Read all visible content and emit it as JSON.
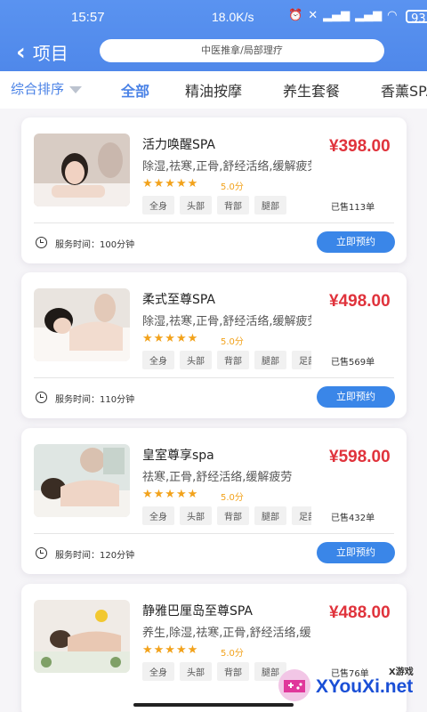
{
  "status_bar": {
    "time": "15:57",
    "speed": "18.0K/s",
    "battery": "93"
  },
  "header": {
    "back_label": "项目",
    "search_text": "中医推拿/局部理疗"
  },
  "tabs": {
    "sort_label": "综合排序",
    "items": [
      "全部",
      "精油按摩",
      "养生套餐",
      "香薰SPA"
    ],
    "active": "全部"
  },
  "colors": {
    "accent": "#4a82e6",
    "price": "#e0333c",
    "button": "#3a86e8",
    "star": "#f2a21b"
  },
  "products": [
    {
      "title": "活力唤醒SPA",
      "tags": "除湿,祛寒,正骨,舒经活络,缓解疲劳",
      "stars": "★★★★★",
      "score": "5.0分",
      "chips": [
        "全身",
        "头部",
        "背部",
        "腿部"
      ],
      "price": "¥398.00",
      "sold": "已售113单",
      "duration": "服务时间：100分钟",
      "book_label": "立即预约"
    },
    {
      "title": "柔式至尊SPA",
      "tags": "除湿,祛寒,正骨,舒经活络,缓解疲劳",
      "stars": "★★★★★",
      "score": "5.0分",
      "chips": [
        "全身",
        "头部",
        "背部",
        "腿部",
        "足部"
      ],
      "price": "¥498.00",
      "sold": "已售569单",
      "duration": "服务时间：110分钟",
      "book_label": "立即预约"
    },
    {
      "title": "皇室尊享spa",
      "tags": "祛寒,正骨,舒经活络,缓解疲劳",
      "stars": "★★★★★",
      "score": "5.0分",
      "chips": [
        "全身",
        "头部",
        "背部",
        "腿部",
        "足部"
      ],
      "price": "¥598.00",
      "sold": "已售432单",
      "duration": "服务时间：120分钟",
      "book_label": "立即预约"
    },
    {
      "title": "静雅巴厘岛至尊SPA",
      "tags": "养生,除湿,祛寒,正骨,舒经活络,缓解疲劳",
      "stars": "★★★★★",
      "score": "5.0分",
      "chips": [
        "全身",
        "头部",
        "背部",
        "腿部"
      ],
      "price": "¥488.00",
      "sold": "已售76单"
    }
  ],
  "watermark": {
    "small": "X游戏",
    "big": "XYouXi.net"
  }
}
